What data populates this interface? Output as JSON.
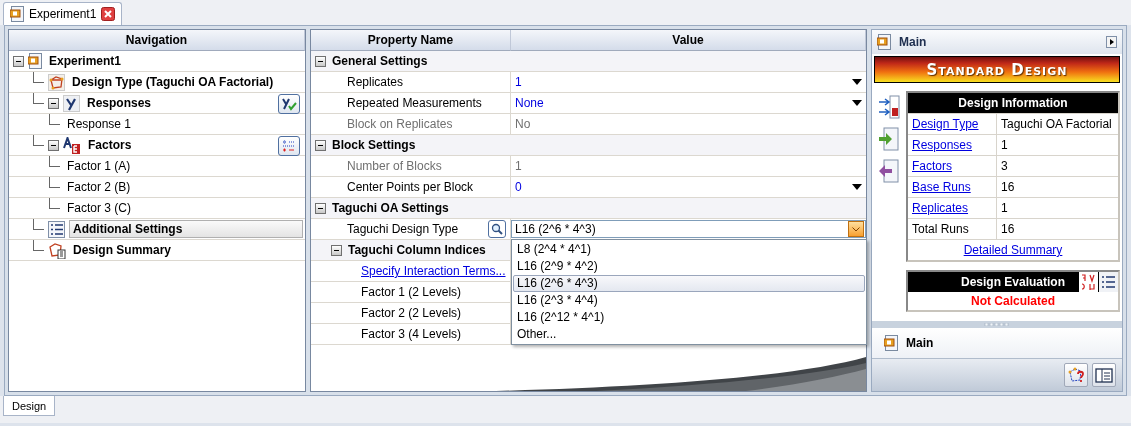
{
  "document_tab": {
    "title": "Experiment1"
  },
  "navigation": {
    "title": "Navigation",
    "tree": [
      {
        "label": "Experiment1",
        "kind": "root",
        "expanded": true,
        "selected": false,
        "children": [
          {
            "label": "Design Type (Taguchi OA Factorial)",
            "kind": "design",
            "selected": false
          },
          {
            "label": "Responses",
            "kind": "responses",
            "expanded": true,
            "selected": false,
            "children": [
              {
                "label": "Response 1",
                "kind": "leaf",
                "selected": false
              }
            ]
          },
          {
            "label": "Factors",
            "kind": "factors",
            "expanded": true,
            "selected": false,
            "children": [
              {
                "label": "Factor 1 (A)",
                "kind": "leaf",
                "selected": false
              },
              {
                "label": "Factor 2 (B)",
                "kind": "leaf",
                "selected": false
              },
              {
                "label": "Factor 3 (C)",
                "kind": "leaf",
                "selected": false
              }
            ]
          },
          {
            "label": "Additional Settings",
            "kind": "settings",
            "selected": true
          },
          {
            "label": "Design Summary",
            "kind": "summary",
            "selected": false
          }
        ]
      }
    ]
  },
  "property_grid": {
    "columns": [
      "Property Name",
      "Value"
    ],
    "sections": [
      {
        "title": "General Settings",
        "expanded": true,
        "rows": [
          {
            "name": "Replicates",
            "value": "1",
            "disabled": false,
            "dropdown": true
          },
          {
            "name": "Repeated Measurements",
            "value": "None",
            "disabled": false,
            "dropdown": true
          },
          {
            "name": "Block on Replicates",
            "value": "No",
            "disabled": true,
            "dropdown": false
          }
        ]
      },
      {
        "title": "Block Settings",
        "expanded": true,
        "rows": [
          {
            "name": "Number of Blocks",
            "value": "1",
            "disabled": true,
            "dropdown": false
          },
          {
            "name": "Center Points per Block",
            "value": "0",
            "disabled": false,
            "dropdown": true
          }
        ]
      },
      {
        "title": "Taguchi OA Settings",
        "expanded": true,
        "rows": [
          {
            "kind": "combo",
            "name": "Taguchi Design Type",
            "value": "L16 (2^6 * 4^3)",
            "open": true,
            "options": [
              {
                "label": "L8 (2^4 * 4^1)",
                "selected": false
              },
              {
                "label": "L16 (2^9 * 4^2)",
                "selected": false
              },
              {
                "label": "L16 (2^6 * 4^3)",
                "selected": true
              },
              {
                "label": "L16 (2^3 * 4^4)",
                "selected": false
              },
              {
                "label": "L16 (2^12 * 4^1)",
                "selected": false
              },
              {
                "label": "Other...",
                "selected": false
              }
            ]
          },
          {
            "kind": "subsection",
            "name": "Taguchi Column Indices",
            "expanded": true,
            "rows": [
              {
                "kind": "link",
                "name": "Specify Interaction Terms..."
              },
              {
                "kind": "plain",
                "name": "Factor 1 (2 Levels)"
              },
              {
                "kind": "plain",
                "name": "Factor 2 (2 Levels)"
              },
              {
                "kind": "plain",
                "name": "Factor 3 (4 Levels)"
              }
            ]
          }
        ]
      }
    ]
  },
  "side_panel": {
    "title": "Main",
    "banner": "Standard Design",
    "design_information": {
      "title": "Design Information",
      "rows": [
        {
          "label": "Design Type",
          "value": "Taguchi OA Factorial",
          "link": true
        },
        {
          "label": "Responses",
          "value": "1",
          "link": true
        },
        {
          "label": "Factors",
          "value": "3",
          "link": true
        },
        {
          "label": "Base Runs",
          "value": "16",
          "link": true
        },
        {
          "label": "Replicates",
          "value": "1",
          "link": true
        },
        {
          "label": "Total Runs",
          "value": "16",
          "link": false
        }
      ],
      "footer_link": "Detailed Summary"
    },
    "design_evaluation": {
      "title": "Design Evaluation",
      "status": "Not Calculated"
    },
    "bottom_section": {
      "title": "Main"
    }
  },
  "bottom_tabs": [
    {
      "label": "Design",
      "selected": true
    }
  ]
}
